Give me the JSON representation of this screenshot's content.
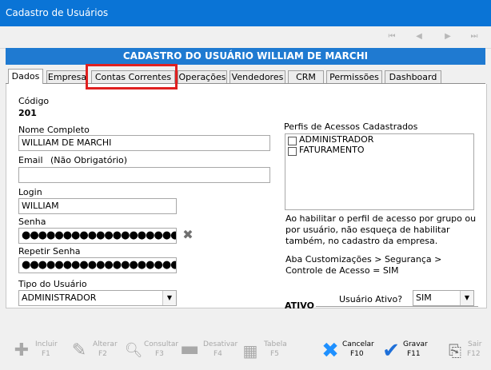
{
  "window": {
    "title": "Cadastro de Usuários"
  },
  "nav": {
    "first": "⏮",
    "prev": "◀",
    "next": "▶",
    "last": "⏭"
  },
  "header": {
    "title": "CADASTRO DO USUÁRIO WILLIAM DE MARCHI"
  },
  "tabs": [
    "Dados",
    "Empresa",
    "Contas Correntes",
    "Operações",
    "Vendedores",
    "CRM",
    "Permissões",
    "Dashboard"
  ],
  "active_tab": "Dados",
  "form": {
    "codigo_label": "Código",
    "codigo_value": "201",
    "nome_label": "Nome Completo",
    "nome_value": "WILLIAM DE MARCHI",
    "email_label": "Email",
    "email_note": "(Não Obrigatório)",
    "email_value": "",
    "login_label": "Login",
    "login_value": "WILLIAM",
    "senha_label": "Senha",
    "senha_value": "●●●●●●●●●●●●●●●●●●●●●●●●●●●●●",
    "repetir_label": "Repetir Senha",
    "repetir_value": "●●●●●●●●●●●●●●●●●●●●●●●●●●●●●",
    "tipo_label": "Tipo do Usuário",
    "tipo_value": "ADMINISTRADOR"
  },
  "perfis": {
    "label": "Perfis de Acessos Cadastrados",
    "items": [
      {
        "label": "ADMINISTRADOR",
        "checked": false
      },
      {
        "label": "FATURAMENTO",
        "checked": false
      }
    ],
    "note1_lines": [
      "Ao habilitar o perfil de acesso por grupo ou",
      "por usuário, não esqueça de habilitar",
      "também, no cadastro da empresa."
    ],
    "note2_lines": [
      "Aba Customizações > Segurança >",
      "Controle de Acesso = SIM"
    ]
  },
  "ativo": {
    "section_label": "ATIVO",
    "field_label": "Usuário Ativo?",
    "value": "SIM"
  },
  "toolbar": [
    {
      "name": "incluir",
      "line1": "Incluir",
      "line2": "F1",
      "icon": "plus-icon",
      "enabled": false
    },
    {
      "name": "alterar",
      "line1": "Alterar",
      "line2": "F2",
      "icon": "pencil-icon",
      "enabled": false
    },
    {
      "name": "consultar",
      "line1": "Consultar",
      "line2": "F3",
      "icon": "magnifier-icon",
      "enabled": false
    },
    {
      "name": "desativar",
      "line1": "Desativar",
      "line2": "F4",
      "icon": "minus-icon",
      "enabled": false
    },
    {
      "name": "tabela",
      "line1": "Tabela",
      "line2": "F5",
      "icon": "table-icon",
      "enabled": false
    },
    {
      "name": "cancelar",
      "line1": "Cancelar",
      "line2": "F10",
      "icon": "x-icon",
      "enabled": true
    },
    {
      "name": "gravar",
      "line1": "Gravar",
      "line2": "F11",
      "icon": "check-icon",
      "enabled": true
    },
    {
      "name": "sair",
      "line1": "Sair",
      "line2": "F12",
      "icon": "exit-icon",
      "enabled": false
    }
  ],
  "colors": {
    "titlebar": "#0a74d6",
    "header": "#1f7ad1",
    "highlight": "#e02020",
    "cancel": "#1e90ff",
    "check": "#1e6fd8"
  }
}
